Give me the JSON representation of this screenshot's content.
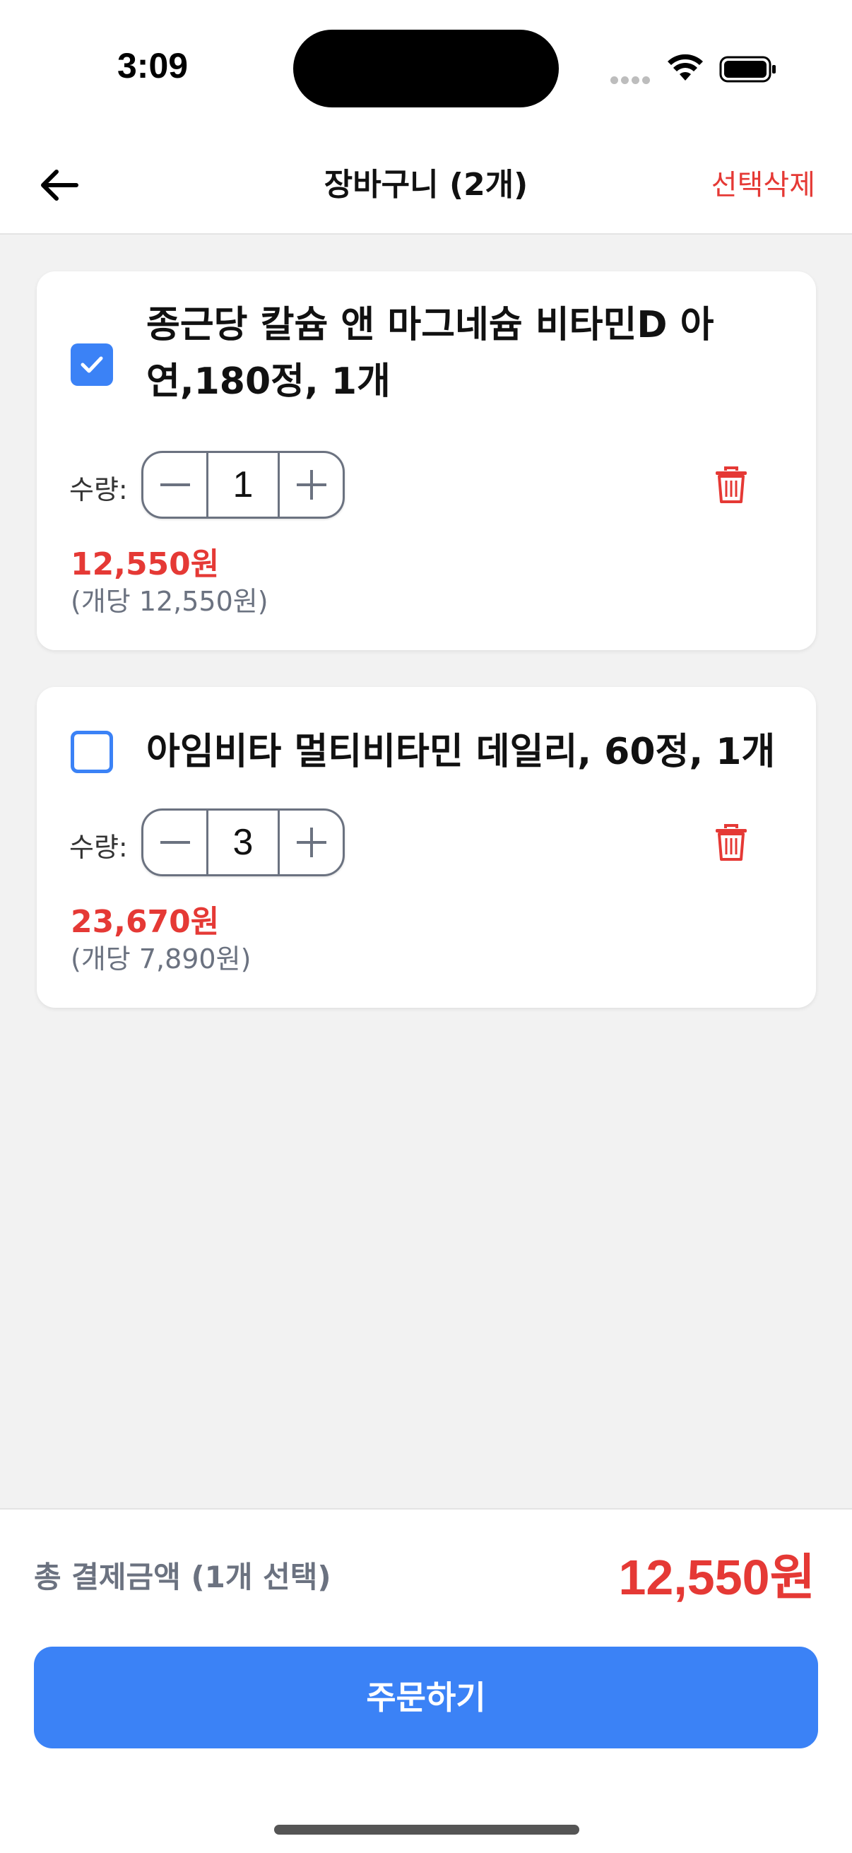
{
  "status_bar": {
    "time": "3:09"
  },
  "header": {
    "title": "장바구니 (2개)",
    "delete_selected_label": "선택삭제"
  },
  "cart": {
    "items": [
      {
        "name": "종근당 칼슘 앤 마그네슘 비타민D 아연,180정, 1개",
        "selected": true,
        "qty_label": "수량:",
        "quantity": "1",
        "price": "12,550원",
        "unit_price": "(개당 12,550원)"
      },
      {
        "name": "아임비타 멀티비타민 데일리, 60정, 1개",
        "selected": false,
        "qty_label": "수량:",
        "quantity": "3",
        "price": "23,670원",
        "unit_price": "(개당 7,890원)"
      }
    ]
  },
  "footer": {
    "total_label": "총 결제금액 (1개 선택)",
    "total_amount": "12,550원",
    "order_button_label": "주문하기"
  },
  "colors": {
    "accent": "#3b82f6",
    "price": "#e53935",
    "background": "#f2f2f2"
  },
  "icons": {
    "back": "arrow-left-icon",
    "check": "checkmark-icon",
    "delete": "trash-icon"
  }
}
